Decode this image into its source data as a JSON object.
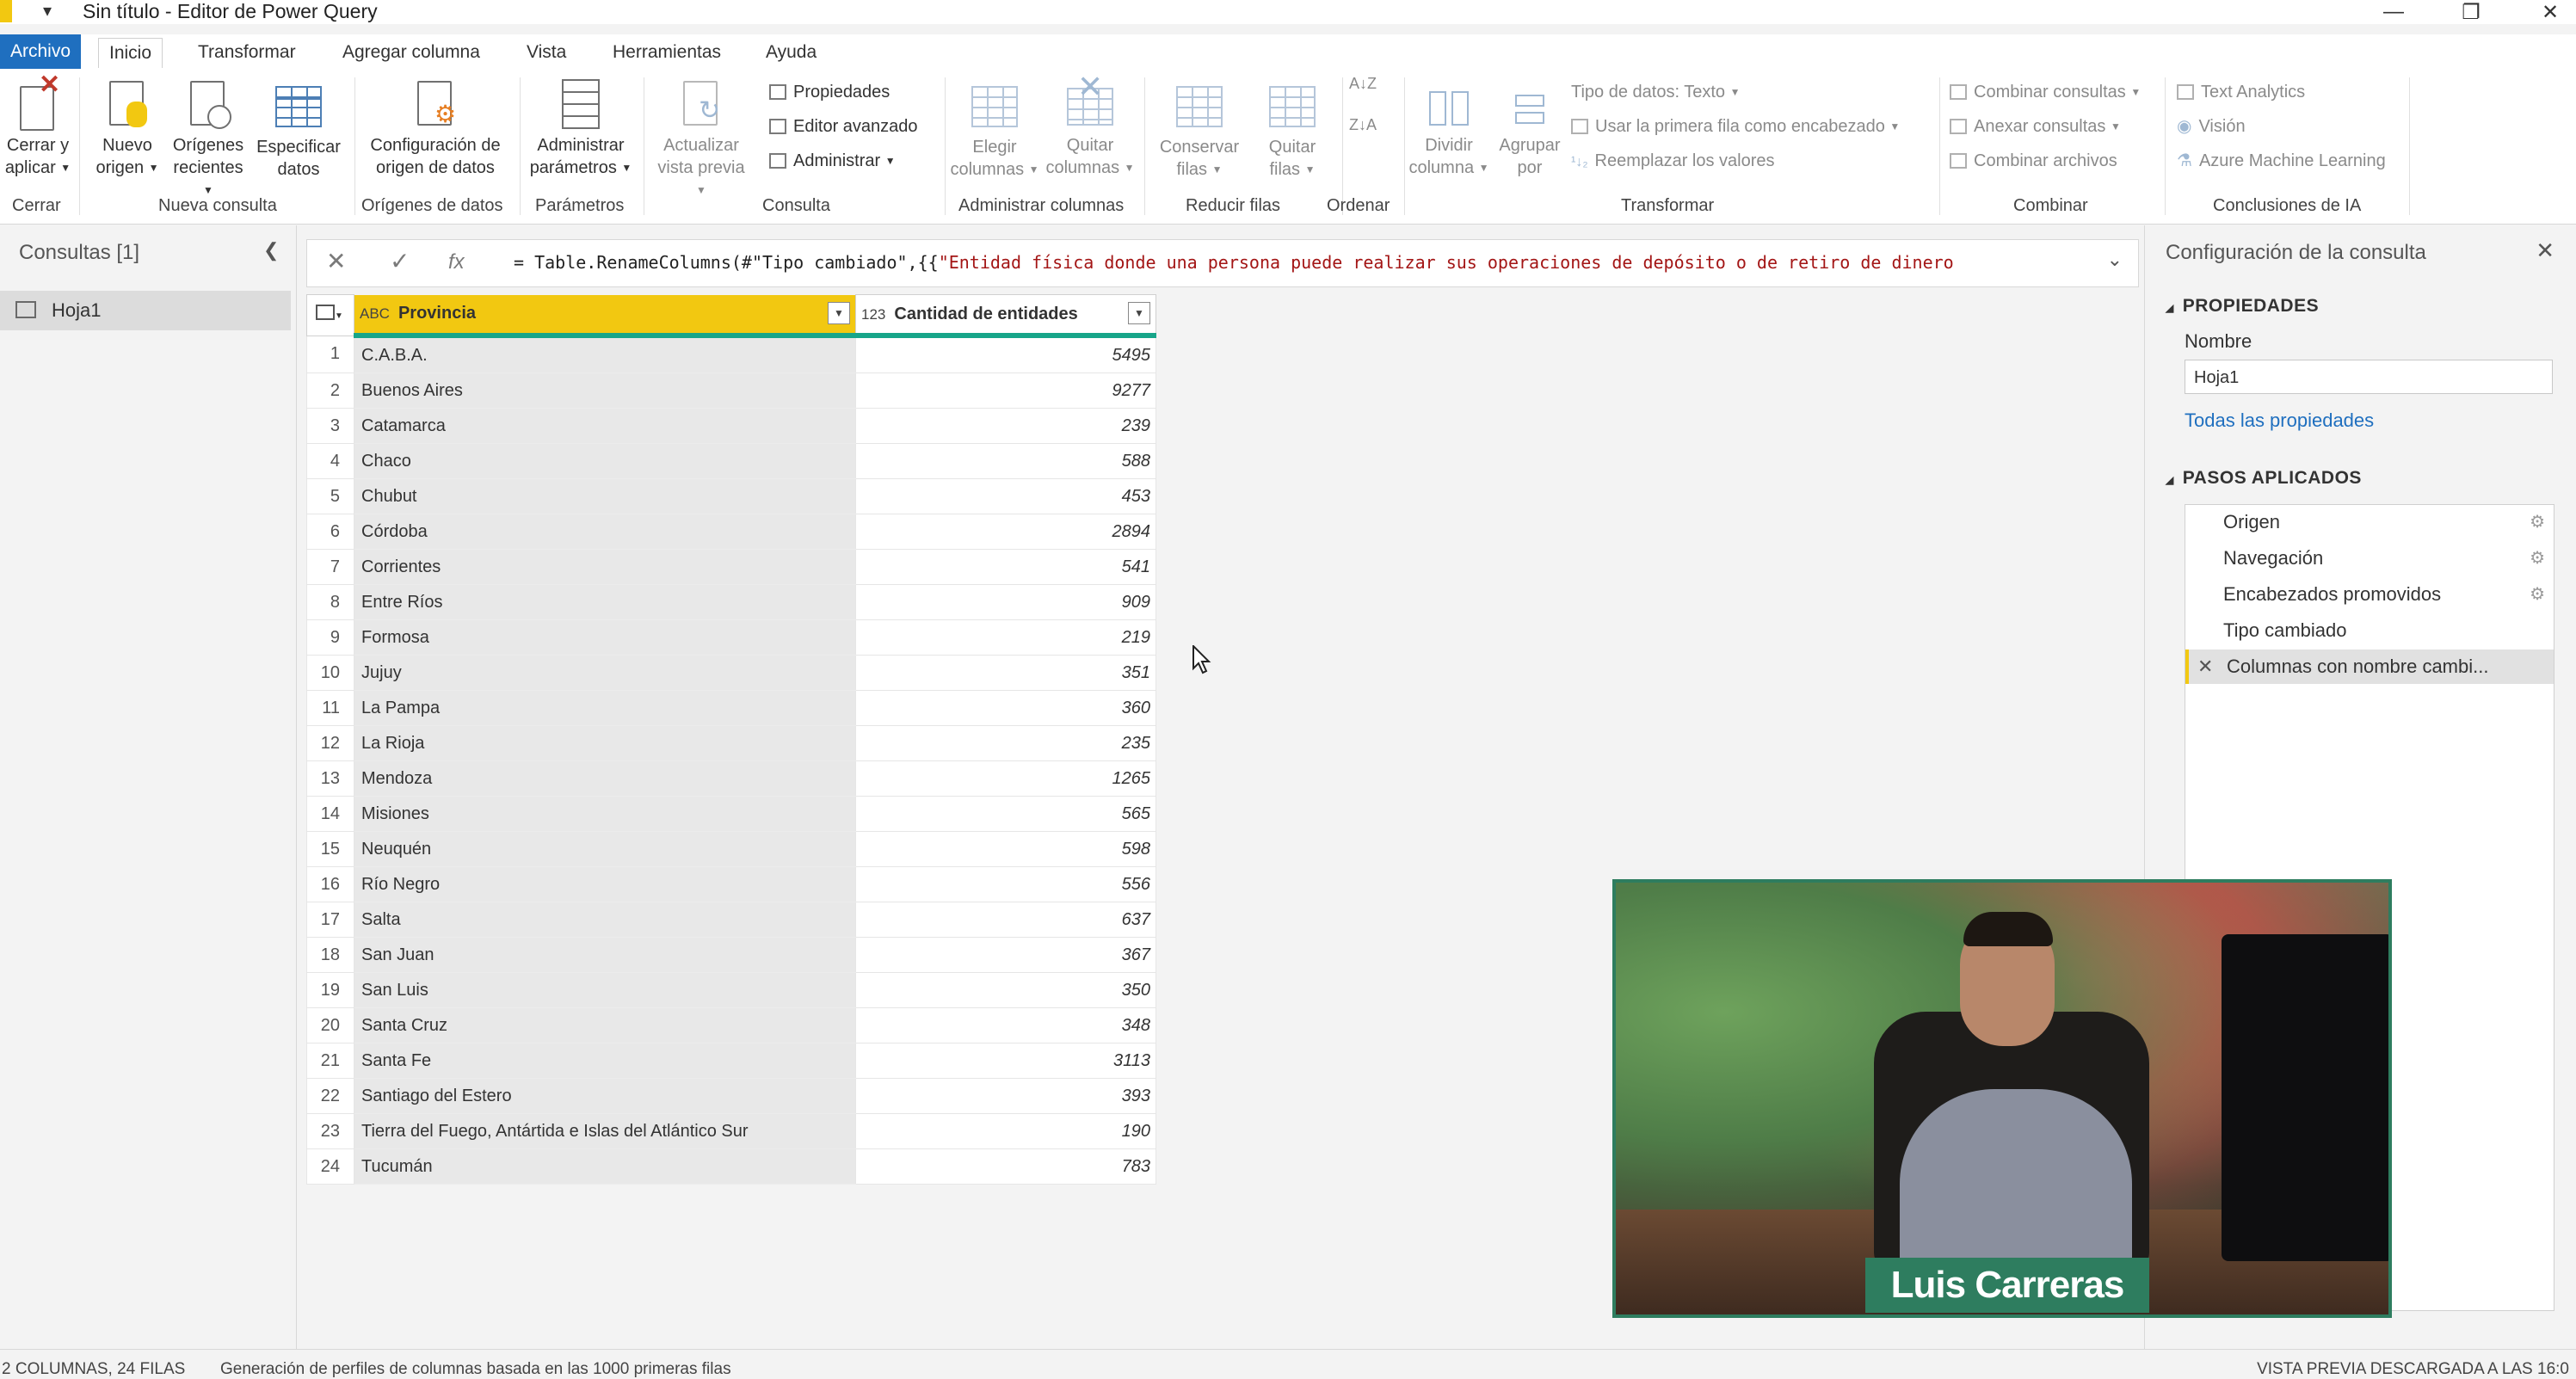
{
  "window": {
    "title": "Sin título - Editor de Power Query",
    "quick_access": "▾",
    "minimize": "—",
    "restore": "❐",
    "close": "✕"
  },
  "tabs": [
    "Archivo",
    "Inicio",
    "Transformar",
    "Agregar columna",
    "Vista",
    "Herramientas",
    "Ayuda"
  ],
  "ribbon": {
    "cerrar": {
      "l1": "Cerrar y",
      "l2": "aplicar",
      "group": "Cerrar"
    },
    "nueva": {
      "nuevo1": "Nuevo",
      "nuevo2": "origen",
      "orig1": "Orígenes",
      "orig2": "recientes",
      "esp1": "Especificar",
      "esp2": "datos",
      "group": "Nueva consulta"
    },
    "origenes": {
      "l1": "Configuración de",
      "l2": "origen de datos",
      "group": "Orígenes de datos"
    },
    "parametros": {
      "l1": "Administrar",
      "l2": "parámetros",
      "group": "Parámetros"
    },
    "consulta": {
      "act1": "Actualizar",
      "act2": "vista previa",
      "propiedades": "Propiedades",
      "editor": "Editor avanzado",
      "administrar": "Administrar",
      "group": "Consulta"
    },
    "columnas": {
      "el1": "Elegir",
      "el2": "columnas",
      "qu1": "Quitar",
      "qu2": "columnas",
      "group": "Administrar columnas"
    },
    "filas": {
      "co1": "Conservar",
      "co2": "filas",
      "qf1": "Quitar",
      "qf2": "filas",
      "group": "Reducir filas"
    },
    "ordenar": {
      "az": "A↓Z",
      "za": "Z↓A",
      "group": "Ordenar"
    },
    "transformar": {
      "div1": "Dividir",
      "div2": "columna",
      "agr1": "Agrupar",
      "agr2": "por",
      "tipo": "Tipo de datos: Texto",
      "usar": "Usar la primera fila como encabezado",
      "reemplazar": "Reemplazar los valores",
      "group": "Transformar"
    },
    "combinar": {
      "comb": "Combinar consultas",
      "anexar": "Anexar consultas",
      "archivos": "Combinar archivos",
      "group": "Combinar"
    },
    "ia": {
      "text": "Text Analytics",
      "vision": "Visión",
      "azure": "Azure Machine Learning",
      "group": "Conclusiones de IA"
    }
  },
  "queries": {
    "header": "Consultas [1]",
    "collapse": "❮",
    "items": [
      {
        "label": "Hoja1"
      }
    ]
  },
  "formula": {
    "cancel": "✕",
    "confirm": "✓",
    "fx": "fx",
    "prefix": "= Table.RenameColumns(#\"Tipo cambiado\",{{",
    "string": "\"Entidad física donde una persona puede realizar sus operaciones de depósito o de retiro de dinero",
    "expand": "⌄"
  },
  "grid": {
    "columns": [
      {
        "type": "ABC",
        "name": "Provincia"
      },
      {
        "type": "123",
        "name": "Cantidad de entidades"
      }
    ],
    "rows": [
      {
        "n": "1",
        "provincia": "C.A.B.A.",
        "cantidad": "5495"
      },
      {
        "n": "2",
        "provincia": "Buenos Aires",
        "cantidad": "9277"
      },
      {
        "n": "3",
        "provincia": "Catamarca",
        "cantidad": "239"
      },
      {
        "n": "4",
        "provincia": "Chaco",
        "cantidad": "588"
      },
      {
        "n": "5",
        "provincia": "Chubut",
        "cantidad": "453"
      },
      {
        "n": "6",
        "provincia": "Córdoba",
        "cantidad": "2894"
      },
      {
        "n": "7",
        "provincia": "Corrientes",
        "cantidad": "541"
      },
      {
        "n": "8",
        "provincia": "Entre Ríos",
        "cantidad": "909"
      },
      {
        "n": "9",
        "provincia": "Formosa",
        "cantidad": "219"
      },
      {
        "n": "10",
        "provincia": "Jujuy",
        "cantidad": "351"
      },
      {
        "n": "11",
        "provincia": "La Pampa",
        "cantidad": "360"
      },
      {
        "n": "12",
        "provincia": "La Rioja",
        "cantidad": "235"
      },
      {
        "n": "13",
        "provincia": "Mendoza",
        "cantidad": "1265"
      },
      {
        "n": "14",
        "provincia": "Misiones",
        "cantidad": "565"
      },
      {
        "n": "15",
        "provincia": "Neuquén",
        "cantidad": "598"
      },
      {
        "n": "16",
        "provincia": "Río Negro",
        "cantidad": "556"
      },
      {
        "n": "17",
        "provincia": "Salta",
        "cantidad": "637"
      },
      {
        "n": "18",
        "provincia": "San Juan",
        "cantidad": "367"
      },
      {
        "n": "19",
        "provincia": "San Luis",
        "cantidad": "350"
      },
      {
        "n": "20",
        "provincia": "Santa Cruz",
        "cantidad": "348"
      },
      {
        "n": "21",
        "provincia": "Santa Fe",
        "cantidad": "3113"
      },
      {
        "n": "22",
        "provincia": "Santiago del Estero",
        "cantidad": "393"
      },
      {
        "n": "23",
        "provincia": "Tierra del Fuego, Antártida e Islas del Atlántico Sur",
        "cantidad": "190"
      },
      {
        "n": "24",
        "provincia": "Tucumán",
        "cantidad": "783"
      }
    ]
  },
  "settings": {
    "header": "Configuración de la consulta",
    "close": "✕",
    "propiedades": "PROPIEDADES",
    "nombre_label": "Nombre",
    "nombre_value": "Hoja1",
    "todas": "Todas las propiedades",
    "pasos": "PASOS APLICADOS",
    "steps": [
      {
        "label": "Origen",
        "gear": "⚙"
      },
      {
        "label": "Navegación",
        "gear": "⚙"
      },
      {
        "label": "Encabezados promovidos",
        "gear": "⚙"
      },
      {
        "label": "Tipo cambiado",
        "gear": ""
      },
      {
        "label": "Columnas con nombre cambi...",
        "gear": "",
        "delete": "✕"
      }
    ]
  },
  "video": {
    "name": "Luis Carreras"
  },
  "status": {
    "left": "2 COLUMNAS, 24 FILAS",
    "profile": "Generación de perfiles de columnas basada en las 1000 primeras filas",
    "right": "VISTA PREVIA DESCARGADA A LAS 16:0"
  },
  "colors": {
    "accent": "#f2c811",
    "file_tab": "#1f6fbf",
    "quality_bar": "#17a589",
    "video_frame": "#2e7d5f"
  }
}
